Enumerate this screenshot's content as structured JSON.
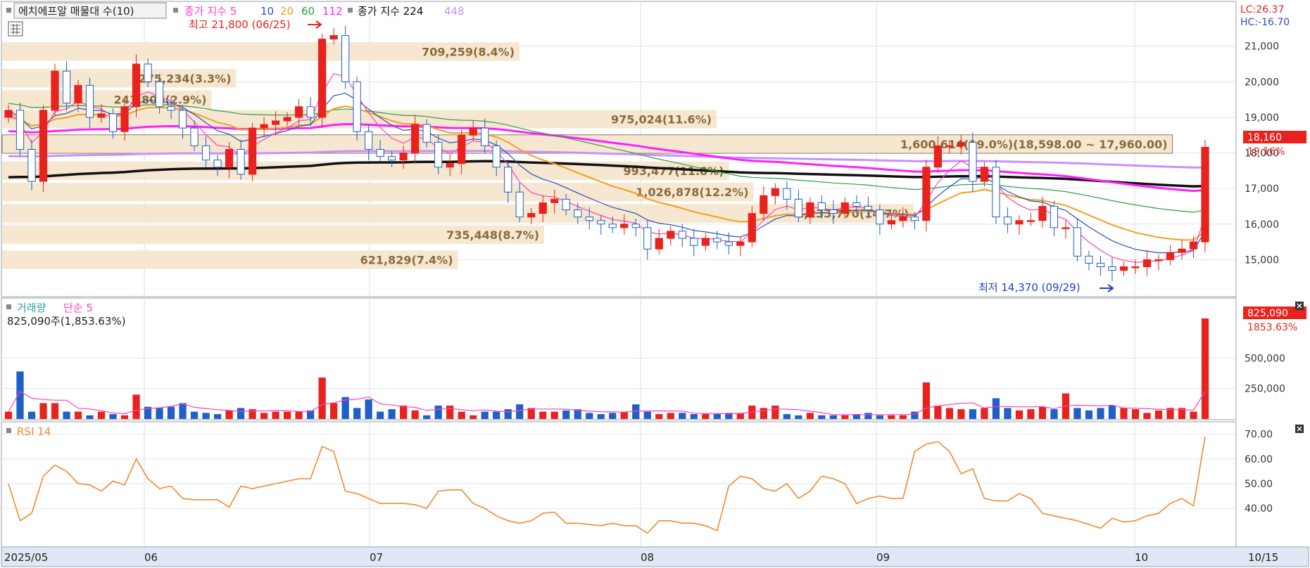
{
  "header": {
    "title": "에치에프알 매물대 수(10)",
    "ma_label": "종가 지수 5",
    "ma_periods": [
      "10",
      "20",
      "60",
      "112"
    ],
    "ma2_label": "종가 지수 224",
    "ma2_period": "448",
    "lc": "LC:26.37",
    "hc": "HC:-16.70"
  },
  "colors": {
    "up": "#e8221c",
    "down": "#1f5fc7",
    "ma5": "#ff40c0",
    "ma10": "#2a4fbf",
    "ma20": "#f0a020",
    "ma60": "#2aa040",
    "ma112": "#ff20ff",
    "ma224": "#111111",
    "ma448": "#c890ff",
    "rsi": "#f08a30",
    "profile": "#f5e4cc"
  },
  "annotations": {
    "high_label": "최고 21,800 (06/25)",
    "low_label": "최저 14,370 (09/29)",
    "current_price": "18,160",
    "current_pct": "19.16%"
  },
  "volume_panel": {
    "title": "거래량",
    "ma_label": "단순 5",
    "summary": "825,090주(1,853.63%)",
    "current_value": "825,090",
    "current_pct": "1853.63%"
  },
  "rsi_panel": {
    "title": "RSI 14"
  },
  "chart_data": {
    "type": "candlestick",
    "x_labels": [
      "2025/05",
      "06",
      "07",
      "08",
      "09",
      "10",
      "10/15"
    ],
    "price_axis": {
      "min": 14000,
      "max": 22200,
      "ticks": [
        "15,000",
        "16,000",
        "17,000",
        "18,000",
        "19,000",
        "20,000",
        "21,000"
      ]
    },
    "volume_axis": {
      "ticks": [
        "250,000",
        "500,000"
      ]
    },
    "rsi_axis": {
      "ticks": [
        "40.00",
        "50.00",
        "60.00",
        "70.00"
      ]
    },
    "volume_profile": [
      {
        "label": "621,829(7.4%)",
        "price": 15000,
        "frac": 0.37
      },
      {
        "label": "735,448(8.7%)",
        "price": 15700,
        "frac": 0.44
      },
      {
        "label": "1,233,770(14.7%)",
        "price": 16300,
        "frac": 0.74
      },
      {
        "label": "1,026,878(12.2%)",
        "price": 16900,
        "frac": 0.61
      },
      {
        "label": "993,477(11.8%)",
        "price": 17500,
        "frac": 0.59
      },
      {
        "label": "1,600,614(19.0%)(18,598.00 ~ 17,960.00)",
        "price": 18250,
        "frac": 0.95
      },
      {
        "label": "975,024(11.6%)",
        "price": 18950,
        "frac": 0.58
      },
      {
        "label": "241,806(2.9%)",
        "price": 19500,
        "frac": 0.17
      },
      {
        "label": "275,234(3.3%)",
        "price": 20100,
        "frac": 0.19
      },
      {
        "label": "709,259(8.4%)",
        "price": 20850,
        "frac": 0.42
      }
    ],
    "closes": [
      19200,
      18100,
      17200,
      19200,
      20300,
      19400,
      19900,
      19000,
      19100,
      18600,
      19300,
      20500,
      20000,
      19300,
      19200,
      18700,
      18200,
      17800,
      17600,
      18100,
      17400,
      18700,
      18800,
      18900,
      19000,
      19300,
      19000,
      21200,
      21300,
      20000,
      18600,
      18100,
      17900,
      17800,
      18000,
      18800,
      18300,
      17600,
      17700,
      18500,
      18700,
      18200,
      17600,
      16900,
      16200,
      16300,
      16600,
      16700,
      16400,
      16200,
      16100,
      16000,
      15900,
      16000,
      15900,
      15300,
      15600,
      15800,
      15600,
      15400,
      15600,
      15500,
      15400,
      15500,
      16300,
      16800,
      17000,
      16700,
      16200,
      16600,
      16400,
      16300,
      16600,
      16500,
      16400,
      16000,
      16100,
      16200,
      16100,
      17600,
      18200,
      18200,
      18300,
      17200,
      17600,
      16200,
      16000,
      16100,
      16100,
      16500,
      15900,
      15900,
      15100,
      14900,
      14800,
      14700,
      14800,
      14800,
      15000,
      15000,
      15200,
      15300,
      15500,
      18160
    ],
    "volume": [
      60000,
      390000,
      60000,
      130000,
      130000,
      60000,
      60000,
      30000,
      60000,
      40000,
      30000,
      200000,
      100000,
      90000,
      100000,
      130000,
      60000,
      50000,
      40000,
      70000,
      90000,
      80000,
      50000,
      60000,
      60000,
      60000,
      70000,
      340000,
      130000,
      180000,
      90000,
      160000,
      60000,
      80000,
      110000,
      70000,
      30000,
      110000,
      110000,
      60000,
      30000,
      60000,
      60000,
      80000,
      120000,
      90000,
      60000,
      60000,
      70000,
      80000,
      50000,
      40000,
      50000,
      60000,
      120000,
      60000,
      40000,
      50000,
      50000,
      40000,
      40000,
      40000,
      50000,
      50000,
      110000,
      90000,
      110000,
      40000,
      30000,
      50000,
      30000,
      30000,
      30000,
      40000,
      50000,
      30000,
      30000,
      30000,
      60000,
      300000,
      110000,
      90000,
      80000,
      80000,
      90000,
      170000,
      90000,
      70000,
      80000,
      100000,
      80000,
      210000,
      90000,
      70000,
      90000,
      110000,
      90000,
      80000,
      50000,
      70000,
      90000,
      90000,
      60000,
      825090
    ],
    "rsi": [
      50.0,
      35.0,
      38.0,
      53.0,
      57.5,
      55.0,
      50.0,
      49.5,
      47.0,
      51.0,
      49.5,
      60.0,
      52.0,
      48.0,
      49.0,
      44.0,
      43.5,
      43.5,
      43.5,
      40.5,
      49.0,
      48.0,
      49.0,
      50.0,
      51.0,
      52.0,
      52.0,
      65.0,
      63.0,
      47.0,
      46.0,
      44.0,
      42.0,
      42.0,
      42.0,
      41.5,
      40.0,
      47.0,
      47.5,
      47.5,
      42.0,
      40.0,
      37.0,
      35.0,
      34.0,
      35.0,
      38.0,
      38.5,
      34.0,
      34.0,
      33.5,
      33.0,
      34.0,
      33.0,
      33.0,
      30.0,
      35.0,
      35.0,
      34.0,
      34.0,
      33.0,
      31.0,
      49.0,
      53.0,
      52.0,
      48.0,
      47.0,
      50.0,
      44.0,
      47.0,
      53.0,
      52.0,
      50.0,
      42.0,
      44.0,
      45.0,
      44.0,
      44.0,
      63.0,
      66.0,
      67.0,
      63.0,
      54.0,
      56.0,
      44.0,
      43.0,
      43.0,
      46.0,
      44.0,
      38.0,
      37.0,
      36.0,
      35.0,
      33.5,
      32.0,
      36.0,
      34.5,
      35.0,
      37.0,
      38.0,
      42.0,
      44.0,
      41.0,
      69.0
    ]
  }
}
